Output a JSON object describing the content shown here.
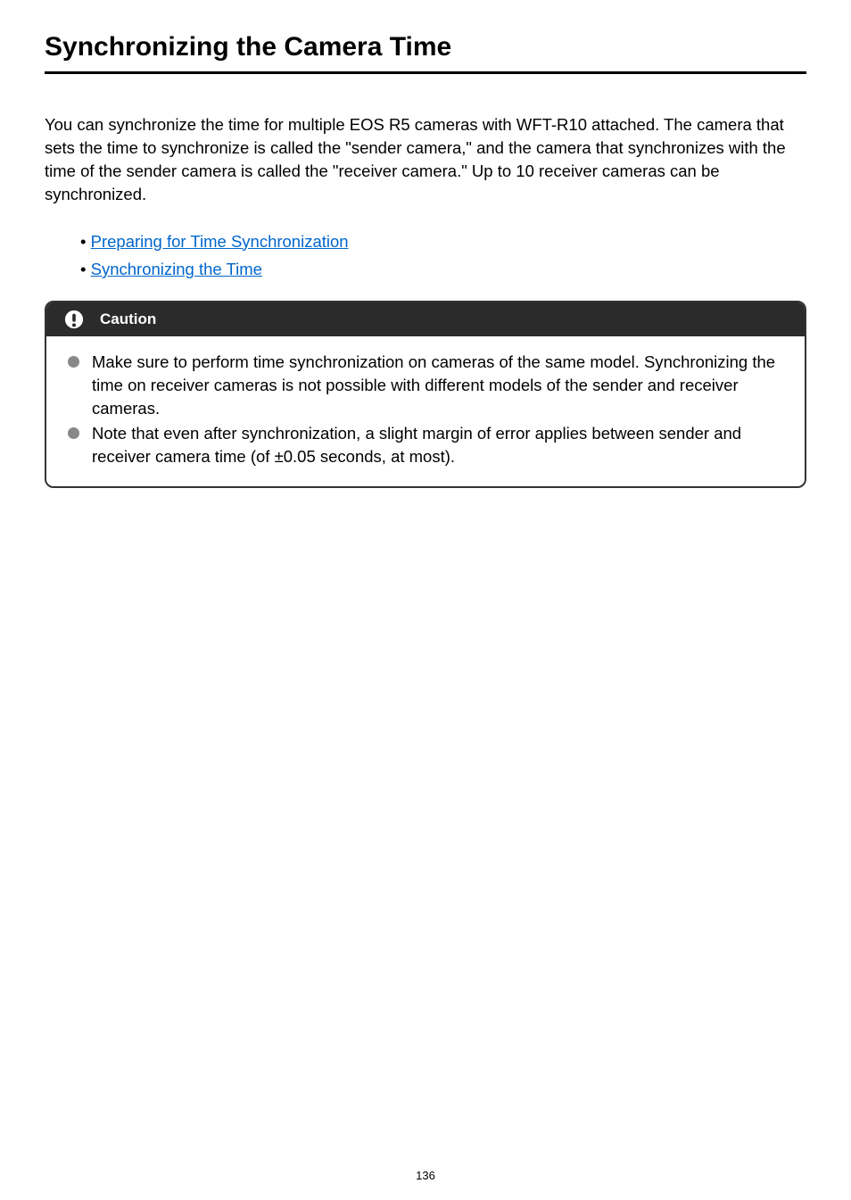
{
  "title": "Synchronizing the Camera Time",
  "intro": "You can synchronize the time for multiple EOS R5 cameras with WFT-R10 attached. The camera that sets the time to synchronize is called the \"sender camera,\" and the camera that synchronizes with the time of the sender camera is called the \"receiver camera.\" Up to 10 receiver cameras can be synchronized.",
  "links": {
    "item1": "Preparing for Time Synchronization",
    "item2": "Synchronizing the Time"
  },
  "caution": {
    "heading": "Caution",
    "item1": "Make sure to perform time synchronization on cameras of the same model. Synchronizing the time on receiver cameras is not possible with different models of the sender and receiver cameras.",
    "item2": "Note that even after synchronization, a slight margin of error applies between sender and receiver camera time (of ±0.05 seconds, at most)."
  },
  "pageNumber": "136"
}
